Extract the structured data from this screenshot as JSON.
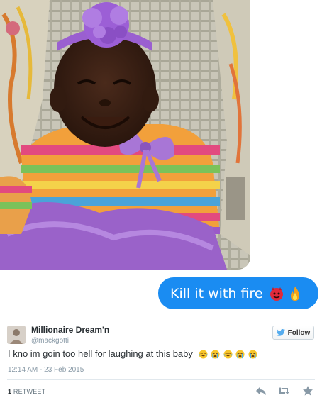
{
  "message": {
    "sent_text": "Kill it with fire",
    "emoji": [
      "devil-emoji",
      "fire-emoji"
    ],
    "colors": {
      "bubble": "#1a8cf2",
      "text": "#ffffff"
    }
  },
  "tweet": {
    "display_name": "Millionaire Dream'n",
    "handle": "@mackgotti",
    "follow_label": "Follow",
    "text": "I kno im goin too hell for laughing at this baby",
    "text_emoji": [
      "joy-emoji",
      "sob-emoji",
      "joy-emoji",
      "sob-emoji",
      "sob-emoji"
    ],
    "timestamp": "12:14 AM - 23 Feb 2015",
    "retweets": {
      "count": "1",
      "label": "RETWEET"
    },
    "actions": [
      "reply-icon",
      "retweet-icon",
      "favorite-icon"
    ],
    "colors": {
      "name": "#292f33",
      "meta": "#8899a6",
      "twitter_blue": "#55acee"
    }
  }
}
